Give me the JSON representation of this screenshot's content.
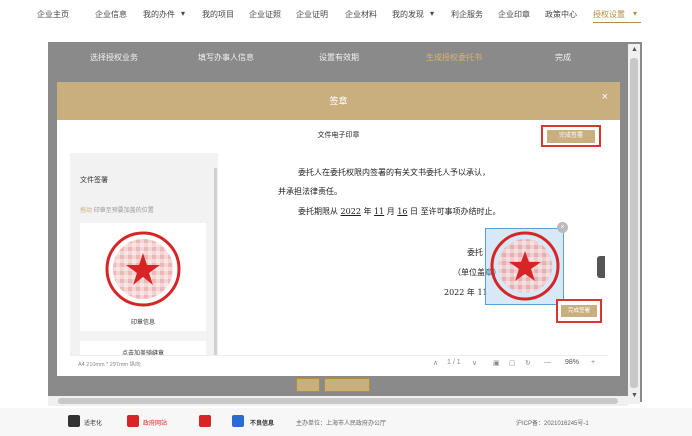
{
  "nav": {
    "items": [
      "企业主页",
      "企业信息",
      "我的办件",
      "我的项目",
      "企业证照",
      "企业证明",
      "企业材料",
      "我的发现",
      "利企服务",
      "企业印章",
      "政策中心",
      "授权设置"
    ],
    "dropdown_mark": "▾",
    "accent_color": "#b58b3e"
  },
  "steps": [
    "选择授权业务",
    "填写办事人信息",
    "设置有效期",
    "生成授权委托书",
    "完成"
  ],
  "modal": {
    "title": "签章",
    "close_icon": "×",
    "doc_title": "文件电子印章",
    "done_top_label": "完成签署",
    "header_color": "#c9ae7e"
  },
  "left_panel": {
    "title": "文件签署",
    "hint_tag": "拖动",
    "hint_text": "印章至预要加盖的位置",
    "seal_caption": "印章信息",
    "add_seal_caption": "点击加盖骑缝章"
  },
  "document": {
    "line1": "委托人在委托权限内签署的有关文书委托人予以承认，",
    "line2": "并承担法律责任。",
    "line3_prefix": "委托期限从",
    "line3_year": "2022",
    "line3_y": "年",
    "line3_month": "11",
    "line3_m": "月",
    "line3_day": "16",
    "line3_d": "日",
    "line3_suffix": "至许可事项办结时止。",
    "sign_label": "委托",
    "unit_label": "（单位盖章）",
    "date_year": "2022",
    "date_y": "年",
    "date_month": "11",
    "done_inner_label": "完成签署",
    "sel_close": "×"
  },
  "viewer": {
    "paper": "A4 210mm * 297mm 纵向",
    "page": "1 / 1",
    "zoom": "98%",
    "prev": "∧",
    "next": "∨",
    "minus": "—",
    "plus": "+"
  },
  "footer": {
    "elder": "适老化",
    "gov": "政府网站",
    "bad": "不良信息",
    "host": "主办单位：上海市人民政府办公厅",
    "icp": "沪ICP备：2021016245号-1"
  }
}
